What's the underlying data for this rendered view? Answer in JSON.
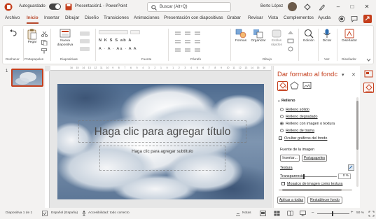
{
  "titlebar": {
    "autosave_label": "Autoguardado",
    "document_title": "Presentación1  -  PowerPoint",
    "search_placeholder": "Buscar (Alt+Q)",
    "user_name": "Berto López"
  },
  "menu": {
    "tabs": [
      "Archivo",
      "Inicio",
      "Insertar",
      "Dibujar",
      "Diseño",
      "Transiciones",
      "Animaciones",
      "Presentación con diapositivas",
      "Grabar",
      "Revisar",
      "Vista",
      "Complementos",
      "Ayuda"
    ],
    "active_tab": "Inicio"
  },
  "ribbon": {
    "undo_label": "Deshacer",
    "paste_label": "Pegar",
    "clipboard_label": "Portapapeles",
    "new_slide_label": "Nueva diapositiva",
    "slides_label": "Diapositivas",
    "font_label": "Fuente",
    "paragraph_label": "Párrafo",
    "shapes_label": "Formas",
    "arrange_label": "Organizar",
    "styles_label": "Estilos rápidos",
    "drawing_label": "Dibujo",
    "editing_label": "Edición",
    "dictate_label": "Dictar",
    "voice_label": "Voz",
    "designer_label": "Diseñador",
    "designer_group_label": "Diseñador",
    "font_row_1": "N  K  S  S  ab  A",
    "font_row_2": "A  ·  A  ·  Aa  ·  A  A"
  },
  "thumbnails": {
    "slide_number": "1"
  },
  "slide": {
    "title_placeholder": "Haga clic para agregar título",
    "subtitle_placeholder": "Haga clic para agregar subtítulo",
    "ruler_numbers": [
      "16",
      "15",
      "14",
      "13",
      "12",
      "11",
      "10",
      "9",
      "8",
      "7",
      "6",
      "5",
      "4",
      "3",
      "2",
      "1",
      "0",
      "1",
      "2",
      "3",
      "4",
      "5",
      "6",
      "7",
      "8",
      "9",
      "10",
      "11",
      "12",
      "13",
      "14",
      "15",
      "16"
    ]
  },
  "pane": {
    "title": "Dar formato al fondc",
    "section_fill": "Relleno",
    "opt_solid": "Relleno sólido",
    "opt_gradient": "Relleno degradado",
    "opt_picture": "Relleno con imagen o textura",
    "opt_pattern": "Relleno de trama",
    "opt_hide_graphics": "Ocultar gráficos del fondo",
    "image_source_label": "Fuente de la imagen",
    "insert_button": "Insertar...",
    "clipboard_button": "Portapapeles",
    "texture_label": "Textura",
    "transparency_label": "Transparencia",
    "transparency_value": "0 %",
    "tile_label": "Mosaico de imagen como textura",
    "apply_all_button": "Aplicar a todas",
    "reset_button": "Restablecer fondo"
  },
  "status": {
    "slide_indicator": "Diapositiva 1 de 1",
    "language": "Español (España)",
    "accessibility": "Accesibilidad: todo correcto",
    "notes_label": "Notas",
    "zoom": "50 %"
  },
  "colors": {
    "accent": "#c43e1c",
    "active_tab": "#b7472a"
  }
}
